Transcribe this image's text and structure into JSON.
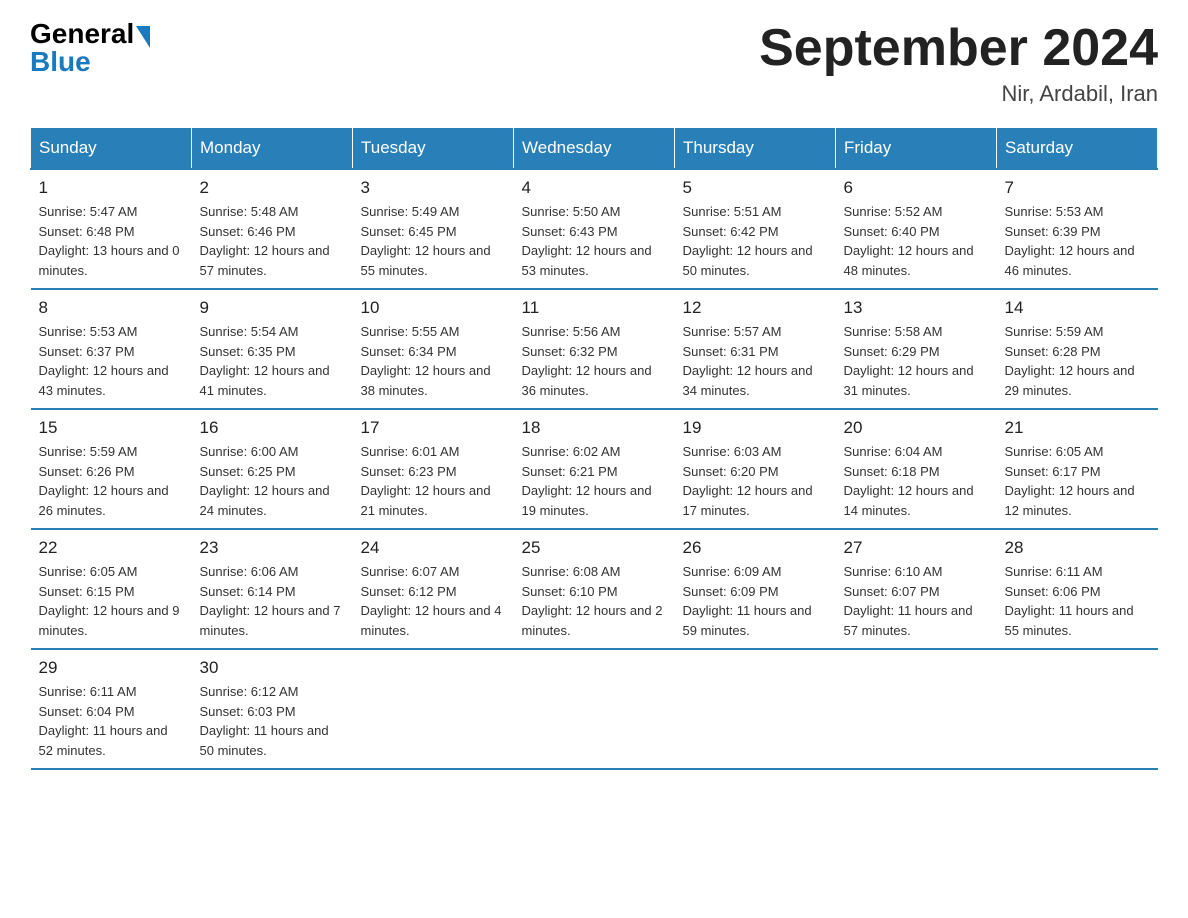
{
  "header": {
    "logo_general": "General",
    "logo_blue": "Blue",
    "month_title": "September 2024",
    "location": "Nir, Ardabil, Iran"
  },
  "weekdays": [
    "Sunday",
    "Monday",
    "Tuesday",
    "Wednesday",
    "Thursday",
    "Friday",
    "Saturday"
  ],
  "weeks": [
    [
      {
        "day": "1",
        "sunrise": "Sunrise: 5:47 AM",
        "sunset": "Sunset: 6:48 PM",
        "daylight": "Daylight: 13 hours and 0 minutes."
      },
      {
        "day": "2",
        "sunrise": "Sunrise: 5:48 AM",
        "sunset": "Sunset: 6:46 PM",
        "daylight": "Daylight: 12 hours and 57 minutes."
      },
      {
        "day": "3",
        "sunrise": "Sunrise: 5:49 AM",
        "sunset": "Sunset: 6:45 PM",
        "daylight": "Daylight: 12 hours and 55 minutes."
      },
      {
        "day": "4",
        "sunrise": "Sunrise: 5:50 AM",
        "sunset": "Sunset: 6:43 PM",
        "daylight": "Daylight: 12 hours and 53 minutes."
      },
      {
        "day": "5",
        "sunrise": "Sunrise: 5:51 AM",
        "sunset": "Sunset: 6:42 PM",
        "daylight": "Daylight: 12 hours and 50 minutes."
      },
      {
        "day": "6",
        "sunrise": "Sunrise: 5:52 AM",
        "sunset": "Sunset: 6:40 PM",
        "daylight": "Daylight: 12 hours and 48 minutes."
      },
      {
        "day": "7",
        "sunrise": "Sunrise: 5:53 AM",
        "sunset": "Sunset: 6:39 PM",
        "daylight": "Daylight: 12 hours and 46 minutes."
      }
    ],
    [
      {
        "day": "8",
        "sunrise": "Sunrise: 5:53 AM",
        "sunset": "Sunset: 6:37 PM",
        "daylight": "Daylight: 12 hours and 43 minutes."
      },
      {
        "day": "9",
        "sunrise": "Sunrise: 5:54 AM",
        "sunset": "Sunset: 6:35 PM",
        "daylight": "Daylight: 12 hours and 41 minutes."
      },
      {
        "day": "10",
        "sunrise": "Sunrise: 5:55 AM",
        "sunset": "Sunset: 6:34 PM",
        "daylight": "Daylight: 12 hours and 38 minutes."
      },
      {
        "day": "11",
        "sunrise": "Sunrise: 5:56 AM",
        "sunset": "Sunset: 6:32 PM",
        "daylight": "Daylight: 12 hours and 36 minutes."
      },
      {
        "day": "12",
        "sunrise": "Sunrise: 5:57 AM",
        "sunset": "Sunset: 6:31 PM",
        "daylight": "Daylight: 12 hours and 34 minutes."
      },
      {
        "day": "13",
        "sunrise": "Sunrise: 5:58 AM",
        "sunset": "Sunset: 6:29 PM",
        "daylight": "Daylight: 12 hours and 31 minutes."
      },
      {
        "day": "14",
        "sunrise": "Sunrise: 5:59 AM",
        "sunset": "Sunset: 6:28 PM",
        "daylight": "Daylight: 12 hours and 29 minutes."
      }
    ],
    [
      {
        "day": "15",
        "sunrise": "Sunrise: 5:59 AM",
        "sunset": "Sunset: 6:26 PM",
        "daylight": "Daylight: 12 hours and 26 minutes."
      },
      {
        "day": "16",
        "sunrise": "Sunrise: 6:00 AM",
        "sunset": "Sunset: 6:25 PM",
        "daylight": "Daylight: 12 hours and 24 minutes."
      },
      {
        "day": "17",
        "sunrise": "Sunrise: 6:01 AM",
        "sunset": "Sunset: 6:23 PM",
        "daylight": "Daylight: 12 hours and 21 minutes."
      },
      {
        "day": "18",
        "sunrise": "Sunrise: 6:02 AM",
        "sunset": "Sunset: 6:21 PM",
        "daylight": "Daylight: 12 hours and 19 minutes."
      },
      {
        "day": "19",
        "sunrise": "Sunrise: 6:03 AM",
        "sunset": "Sunset: 6:20 PM",
        "daylight": "Daylight: 12 hours and 17 minutes."
      },
      {
        "day": "20",
        "sunrise": "Sunrise: 6:04 AM",
        "sunset": "Sunset: 6:18 PM",
        "daylight": "Daylight: 12 hours and 14 minutes."
      },
      {
        "day": "21",
        "sunrise": "Sunrise: 6:05 AM",
        "sunset": "Sunset: 6:17 PM",
        "daylight": "Daylight: 12 hours and 12 minutes."
      }
    ],
    [
      {
        "day": "22",
        "sunrise": "Sunrise: 6:05 AM",
        "sunset": "Sunset: 6:15 PM",
        "daylight": "Daylight: 12 hours and 9 minutes."
      },
      {
        "day": "23",
        "sunrise": "Sunrise: 6:06 AM",
        "sunset": "Sunset: 6:14 PM",
        "daylight": "Daylight: 12 hours and 7 minutes."
      },
      {
        "day": "24",
        "sunrise": "Sunrise: 6:07 AM",
        "sunset": "Sunset: 6:12 PM",
        "daylight": "Daylight: 12 hours and 4 minutes."
      },
      {
        "day": "25",
        "sunrise": "Sunrise: 6:08 AM",
        "sunset": "Sunset: 6:10 PM",
        "daylight": "Daylight: 12 hours and 2 minutes."
      },
      {
        "day": "26",
        "sunrise": "Sunrise: 6:09 AM",
        "sunset": "Sunset: 6:09 PM",
        "daylight": "Daylight: 11 hours and 59 minutes."
      },
      {
        "day": "27",
        "sunrise": "Sunrise: 6:10 AM",
        "sunset": "Sunset: 6:07 PM",
        "daylight": "Daylight: 11 hours and 57 minutes."
      },
      {
        "day": "28",
        "sunrise": "Sunrise: 6:11 AM",
        "sunset": "Sunset: 6:06 PM",
        "daylight": "Daylight: 11 hours and 55 minutes."
      }
    ],
    [
      {
        "day": "29",
        "sunrise": "Sunrise: 6:11 AM",
        "sunset": "Sunset: 6:04 PM",
        "daylight": "Daylight: 11 hours and 52 minutes."
      },
      {
        "day": "30",
        "sunrise": "Sunrise: 6:12 AM",
        "sunset": "Sunset: 6:03 PM",
        "daylight": "Daylight: 11 hours and 50 minutes."
      },
      null,
      null,
      null,
      null,
      null
    ]
  ]
}
